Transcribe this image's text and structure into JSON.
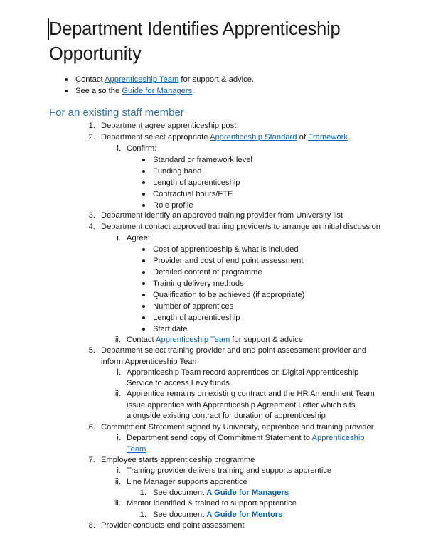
{
  "document": {
    "title": "Department Identifies Apprenticeship Opportunity",
    "intro_bullets": [
      {
        "before": "Contact ",
        "link": "Apprenticeship Team",
        "after": " for support & advice."
      },
      {
        "before": "See also the ",
        "link": "Guide for Managers",
        "after": "."
      }
    ],
    "section_heading": "For an existing staff member",
    "steps": {
      "s1": {
        "num": "1.",
        "text": "Department agree apprenticeship post"
      },
      "s2": {
        "num": "2.",
        "before": "Department select appropriate ",
        "link1": "Apprenticeship Standard",
        "mid": " of ",
        "link2": "Framework",
        "sub_i": {
          "num": "i.",
          "text": "Confirm:",
          "bullets": [
            "Standard or framework level",
            "Funding band",
            "Length of apprenticeship",
            "Contractual hours/FTE",
            "Role profile"
          ]
        }
      },
      "s3": {
        "num": "3.",
        "text": "Department identify an approved training provider from University list"
      },
      "s4": {
        "num": "4.",
        "text": "Department contact approved training provider/s to arrange an initial discussion",
        "sub_i": {
          "num": "i.",
          "text": "Agree:",
          "bullets": [
            "Cost of apprenticeship & what is included",
            "Provider and cost of end point assessment",
            "Detailed content of programme",
            "Training delivery methods",
            "Qualification to be achieved (if appropriate)",
            "Number of apprentices",
            "Length of apprenticeship",
            "Start date"
          ]
        },
        "sub_ii": {
          "num": "ii.",
          "before": "Contact ",
          "link": "Apprenticeship Team",
          "after": " for support & advice"
        }
      },
      "s5": {
        "num": "5.",
        "line1": "Department select training provider and end point assessment provider and",
        "line2": "inform Apprenticeship Team",
        "sub_i": {
          "num": "i.",
          "line1": "Apprenticeship Team record apprentices on Digital Apprenticeship",
          "line2": "Service to access Levy funds"
        },
        "sub_ii": {
          "num": "ii.",
          "line1": "Apprentice remains on existing contract and the HR Amendment Team",
          "line2": "issue apprentice with Apprenticeship Agreement Letter which sits",
          "line3": "alongside existing contract for duration of apprenticeship"
        }
      },
      "s6": {
        "num": "6.",
        "text": "Commitment Statement signed by University, apprentice and training provider",
        "sub_i": {
          "num": "i.",
          "before": "Department send copy of Commitment Statement to ",
          "link_line1": "Apprenticeship",
          "link_line2": "Team"
        }
      },
      "s7": {
        "num": "7.",
        "text": "Employee starts apprenticeship programme",
        "sub_i": {
          "num": "i.",
          "text": "Training provider delivers training and supports apprentice"
        },
        "sub_ii": {
          "num": "ii.",
          "text": "Line Manager supports apprentice",
          "sub_1": {
            "num": "1.",
            "before": "See document ",
            "link": "A Guide for Managers"
          }
        },
        "sub_iii": {
          "num": "iii.",
          "text": "Mentor identified & trained to support apprentice",
          "sub_1": {
            "num": "1.",
            "before": "See document ",
            "link": "A Guide for Mentors"
          }
        }
      },
      "s8": {
        "num": "8.",
        "text": "Provider conducts end point assessment"
      }
    }
  },
  "colors": {
    "link": "#0563c1",
    "heading": "#2e74b5",
    "text": "#1a1a1a"
  }
}
